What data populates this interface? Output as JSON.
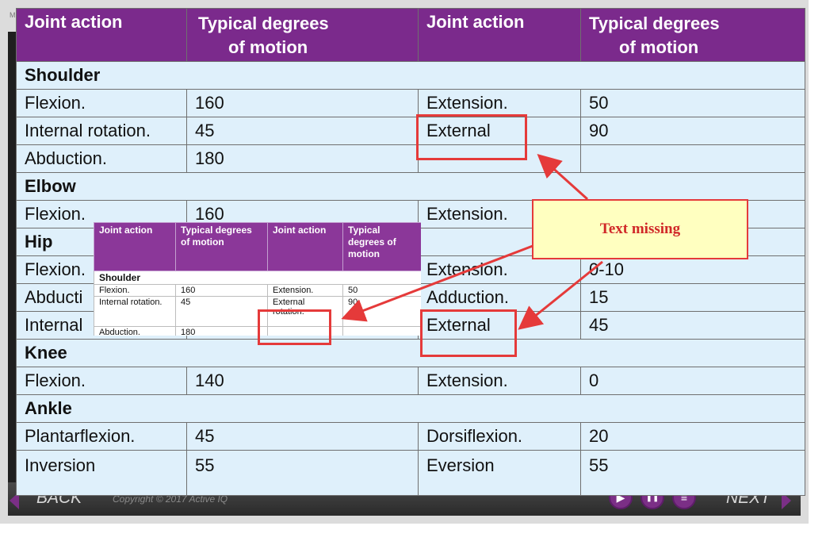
{
  "slide_marker": "M",
  "table": {
    "headers": [
      "Joint action",
      "Typical degrees\nof motion",
      "Joint action",
      "Typical degrees\nof motion"
    ],
    "rows": [
      {
        "type": "section",
        "label": "Shoulder"
      },
      {
        "type": "data",
        "cells": [
          "Flexion.",
          "160",
          "Extension.",
          "50"
        ]
      },
      {
        "type": "data",
        "cells": [
          "Internal rotation.",
          "45",
          "External",
          "90"
        ]
      },
      {
        "type": "data",
        "cells": [
          "Abduction.",
          "180",
          "",
          ""
        ]
      },
      {
        "type": "section",
        "label": "Elbow"
      },
      {
        "type": "data",
        "cells": [
          "Flexion.",
          "160",
          "Extension.",
          ""
        ]
      },
      {
        "type": "section",
        "label": "Hip"
      },
      {
        "type": "data",
        "cells": [
          "Flexion.",
          "",
          "Extension.",
          "0-10"
        ]
      },
      {
        "type": "data",
        "cells": [
          "Abducti",
          "",
          "Adduction.",
          "15"
        ]
      },
      {
        "type": "data",
        "cells": [
          "Internal",
          "",
          "External",
          "45"
        ]
      },
      {
        "type": "section",
        "label": "Knee"
      },
      {
        "type": "data",
        "cells": [
          "Flexion.",
          "140",
          "Extension.",
          "0"
        ]
      },
      {
        "type": "section",
        "label": "Ankle"
      },
      {
        "type": "data",
        "cells": [
          "Plantarflexion.",
          "45",
          "Dorsiflexion.",
          "20"
        ]
      },
      {
        "type": "data",
        "cells": [
          "Inversion",
          "55",
          "Eversion",
          "55"
        ]
      }
    ]
  },
  "inset_table": {
    "headers": [
      "Joint action",
      "Typical degrees of motion",
      "Joint action",
      "Typical degrees of motion"
    ],
    "section": "Shoulder",
    "rows": [
      [
        "Flexion.",
        "160",
        "Extension.",
        "50"
      ],
      [
        "Internal rotation.",
        "45",
        "External rotation.",
        "90"
      ],
      [
        "Abduction.",
        "180",
        "",
        ""
      ]
    ]
  },
  "callout": {
    "text": "Text missing"
  },
  "bottom_bar": {
    "back_label": "BACK",
    "next_label": "NEXT",
    "copyright": "Copyright © 2017 Active IQ",
    "play_icon": "▶",
    "pause_icon": "❚❚",
    "notes_icon": "≡"
  },
  "colors": {
    "header_bg": "#7b2a8c",
    "cell_bg": "#dff0fb",
    "annotation_red": "#e53a3a",
    "callout_bg": "#ffffc0"
  }
}
